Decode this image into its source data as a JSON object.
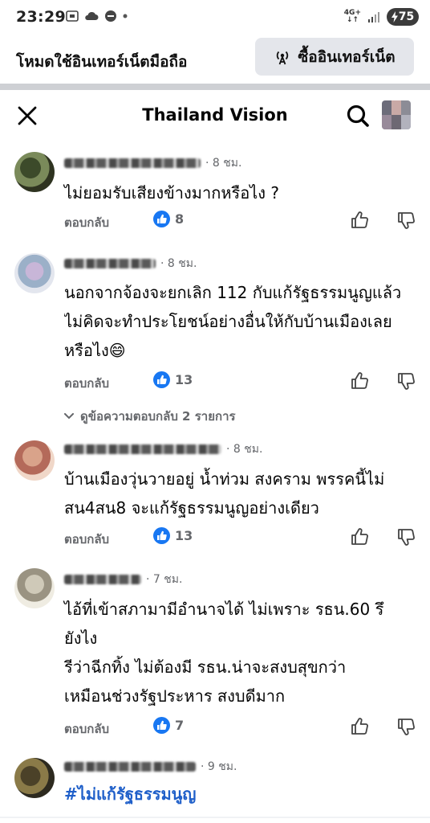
{
  "status_bar": {
    "time": "23:29",
    "network_label_top": "4G+",
    "network_label_bottom": "↓↑",
    "battery": "75"
  },
  "banner": {
    "text": "โหมดใช้อินเทอร์เน็ตมือถือ",
    "button_label": "ซื้ออินเทอร์เน็ต"
  },
  "header": {
    "title": "Thailand Vision"
  },
  "comments": [
    {
      "timestamp": "· 8 ชม.",
      "text": "ไม่ยอมรับเสียงข้างมากหรือไง ?",
      "reply_label": "ตอบกลับ",
      "likes": "8"
    },
    {
      "timestamp": "· 8 ชม.",
      "text": "นอกจากจ้องจะยกเลิก 112 กับแก้รัฐธรรมนูญแล้ว ไม่คิดจะทำประโยชน์อย่างอื่นให้กับบ้านเมืองเลยหรือไง😄",
      "reply_label": "ตอบกลับ",
      "likes": "13"
    },
    {
      "timestamp": "· 8 ชม.",
      "text": "บ้านเมืองวุ่นวายอยู่ น้ำท่วม  สงคราม พรรคนี้ไม่สน4สน8 จะแก้รัฐธรรมนูญอย่างเดียว",
      "reply_label": "ตอบกลับ",
      "likes": "13"
    },
    {
      "timestamp": "· 7 ชม.",
      "text_lines": [
        "ไอ้ที่เข้าสภามามีอำนาจได้ ไม่เพราะ รธน.60 รึ",
        "ยังไง",
        "รีว่าฉีกทิ้ง ไม่ต้องมี รธน.น่าจะสงบสุขกว่า",
        "เหมือนช่วงรัฐประหาร สงบดีมาก"
      ],
      "reply_label": "ตอบกลับ",
      "likes": "7"
    },
    {
      "timestamp": "· 9 ชม.",
      "hashtag": "#ไม่แก้รัฐธรรมนูญ"
    }
  ],
  "view_replies": "ดูข้อความตอบกลับ 2 รายการ",
  "icons": {
    "close": "close-icon",
    "search": "search-icon",
    "like_badge": "thumbs-up-icon",
    "like": "like-icon",
    "dislike": "dislike-icon",
    "broadcast": "broadcast-icon",
    "chevron": "chevron-down-icon"
  },
  "colors": {
    "accent": "#1877f2",
    "hashtag": "#1f5fc9",
    "muted": "#65676b",
    "banner_button": "#e4e6eb"
  }
}
